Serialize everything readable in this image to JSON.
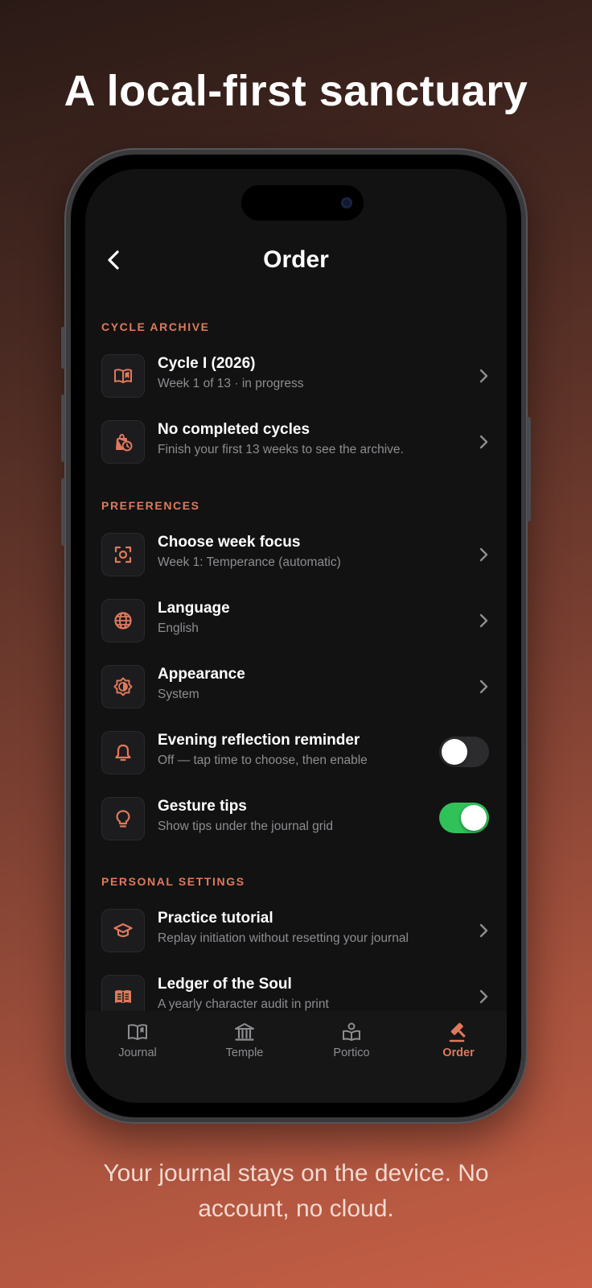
{
  "headline": "A local-first sanctuary",
  "footer": "Your journal stays on the device. No account, no cloud.",
  "colors": {
    "accent": "#e0795c",
    "toggle_on": "#30c158",
    "background": "#121212"
  },
  "screen": {
    "title": "Order",
    "sections": [
      {
        "label": "CYCLE ARCHIVE",
        "rows": [
          {
            "icon": "open-book-icon",
            "title": "Cycle I (2026)",
            "subtitle": "Week 1 of 13 · in progress",
            "control": "chevron"
          },
          {
            "icon": "bag-clock-icon",
            "title": "No completed cycles",
            "subtitle": "Finish your first 13 weeks to see the archive.",
            "control": "chevron"
          }
        ]
      },
      {
        "label": "PREFERENCES",
        "rows": [
          {
            "icon": "focus-target-icon",
            "title": "Choose week focus",
            "subtitle": "Week 1: Temperance (automatic)",
            "control": "chevron"
          },
          {
            "icon": "globe-icon",
            "title": "Language",
            "subtitle": "English",
            "control": "chevron"
          },
          {
            "icon": "appearance-icon",
            "title": "Appearance",
            "subtitle": "System",
            "control": "chevron"
          },
          {
            "icon": "bell-icon",
            "title": "Evening reflection reminder",
            "subtitle": "Off — tap time to choose, then enable",
            "control": "toggle",
            "on": false
          },
          {
            "icon": "lightbulb-icon",
            "title": "Gesture tips",
            "subtitle": "Show tips under the journal grid",
            "control": "toggle",
            "on": true
          }
        ]
      },
      {
        "label": "PERSONAL SETTINGS",
        "rows": [
          {
            "icon": "graduation-cap-icon",
            "title": "Practice tutorial",
            "subtitle": "Replay initiation without resetting your journal",
            "control": "chevron"
          },
          {
            "icon": "ledger-book-icon",
            "title": "Ledger of the Soul",
            "subtitle": "A yearly character audit in print",
            "control": "chevron"
          }
        ]
      }
    ],
    "tabs": [
      {
        "label": "Journal",
        "icon": "open-book-icon",
        "active": false
      },
      {
        "label": "Temple",
        "icon": "temple-icon",
        "active": false
      },
      {
        "label": "Portico",
        "icon": "portico-icon",
        "active": false
      },
      {
        "label": "Order",
        "icon": "gavel-icon",
        "active": true
      }
    ]
  }
}
